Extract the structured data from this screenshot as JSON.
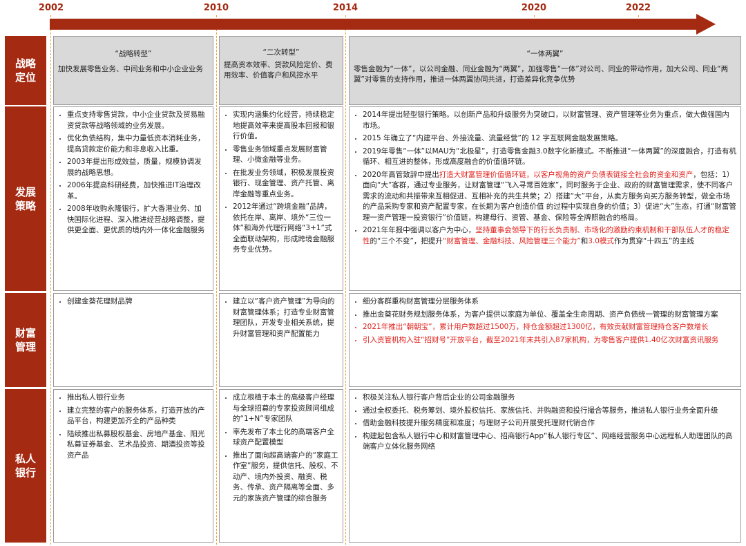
{
  "timeline": {
    "years": [
      "2002",
      "2010",
      "2014",
      "2020",
      "2022"
    ],
    "arrow_color": "#a52a12"
  },
  "rows": {
    "position": "战略\n定位",
    "strategy": "发展\n策略",
    "wealth": "财富\n管理",
    "private": "私人\n银行"
  },
  "position": {
    "col1": {
      "title": "“战略转型”",
      "text": "加快发展零售业务、中间业务和中小企业业务"
    },
    "col2": {
      "title": "“二次转型”",
      "text": "提高资本效率、贷款风险定价、费用效率、价值客户和风控水平"
    },
    "col3": {
      "title": "“一体两翼”",
      "text": "零售金融为“一体”，以公司金融、同业金融为“两翼”，加强零售“一体”对公司、同业的带动作用，加大公司、同业“两翼”对零售的支持作用，推进一体两翼协同共进，打造差异化竞争优势"
    }
  },
  "strategy": {
    "col1": [
      "重点支持零售贷款，中小企业贷款及贸易融资贷款等战略领域的业务发展。",
      "优化负债结构，集中力量低资本消耗业务，提高贷款定价能力和非息收入比重。",
      "2003年提出形成效益，质量，规模协调发展的战略思想。",
      "2006年提高科研经费，加快推进IT治理改革。",
      "2008年收购永隆银行，扩大香港业务、加快国际化进程、深入推进经营战略调整，提供更全面、更优质的境内外一体化金融服务"
    ],
    "col2": [
      "实现内涵集约化经营，持续稳定地提高效率来提高股本回报和银行价值。",
      "零售业务领域重点发展财富管理、小微金融等业务。",
      "在批发业务领域，积极发展投资银行、现金管理、资产托管、离岸金融等重点业务。",
      "2012年通过“跨境金融”品牌，依托在岸、离岸、境外“三位一体”和海外代理行网络“3+1”式全面联动架构，形成跨境金融服务专业优势。"
    ],
    "col3": {
      "item1": "2014年提出轻型银行策略。以创新产品和升级服务为突破口，以财富管理、资产管理等业务为重点，做大做强国内市场。",
      "item2": "2015 年确立了“内建平台、外接流量、流量经营”的 12 字互联网金融发展策略。",
      "item3": "2019年零售“一体”以MAU为“北极星”，打造零售金融3.0数字化新模式。不断推进“一体两翼”的深度融合，打造有机循环、相互进的整体，形成高度融合的价值循环链。",
      "item4_a": "2020年高管致辞中提出",
      "item4_red": "打造大财富管理价值循环链，以客户视角的资产负债表链接全社会的资金和资产",
      "item4_b": "，包括：1）面向“大”客群，通过专业服务，让财富管理“飞入寻常百姓家”，同时服务于企业、政府的财富管理需求，使不同客户需求的流动和共振带来互相促进、互相补充的共生共荣；2）搭建“大”平台，从卖方服务向买方服务转型，做全市场的产品采购专家和资产配置专家，在长期为客户创造价值 的过程中实现自身的价值；3）促进“大”生态，打通“财富管理一资产管理一投资银行”价值链，构建母行、资管、基金、保险等全牌照融合的格局。",
      "item5_a": "2021年年报中强调以客户为中心，",
      "item5_red": "坚持董事会领导下的行长负责制、市场化的激励约束机制和干部队伍人才的稳定性",
      "item5_b": "的“三个不变”，把提升",
      "item5_red2": "“财富管理、金融科技、风险管理三个能力”",
      "item5_c": "和",
      "item5_red3": "3.0模式",
      "item5_d": "作为贯穿“十四五”的主线"
    }
  },
  "wealth": {
    "col1": [
      "创建金葵花理财品牌"
    ],
    "col2": [
      "建立以“客户资产管理”为导向的财富管理体系；打造专业财富管理团队，开发专业相关系统，提升财富管理和资产配置能力"
    ],
    "col3": [
      {
        "text": "细分客群重构财富管理分层服务体系",
        "red": false
      },
      {
        "text": "推出金葵花财务规划服务体系，为客户提供以家庭为单位、覆盖全生命周期、资产负债统一管理的财富管理方案",
        "red": false
      },
      {
        "text": "2021年推出“朝朝宝”，累计用户数超过1500万，持仓金额超过1300亿，有效贡献财富管理持仓客户数增长",
        "red": true
      },
      {
        "text": "引入资管机构入驻“招财号”开放平台，截至2021年末共引入87家机构，为零售客户提供1.40亿次财富资讯服务",
        "red": true
      }
    ]
  },
  "private": {
    "col1": [
      "推出私人银行业务",
      "建立完整的客户的服务体系，打造开放的产品平台，构建更加齐全的产品种类",
      "陆续推出私募股权基金、房地产基金、阳光私募证券基金、艺术品投资、期酒投资等投资产品"
    ],
    "col2": [
      "成立根植于本土的高级客户经理与全球招募的专家投资顾问组成的“1+N”专家团队",
      "率先发布了本土化的高端客户全球资产配置模型",
      "推出了面向超高端客户的“家庭工作室”服务，提供信托、股权、不动产、境内外投资、融资、税务、传承、资产隔离等全面、多元的家族资产管理的综合服务"
    ],
    "col3": [
      "积极关注私人银行客户背后企业的公司金融服务",
      "通过全权委托、税务筹划、境外股权信托、家族信托、并购融资和投行撮合等服务，推进私人银行业务全面升级",
      "借助金融科技提升服务精度和准度；与理财子公司开展受托理财代销合作",
      "构建起包含私人银行中心和财富管理中心、招商银行App“私人银行专区”、网络经营服务中心远程私人助理团队的高端客户立体化服务网络"
    ]
  }
}
